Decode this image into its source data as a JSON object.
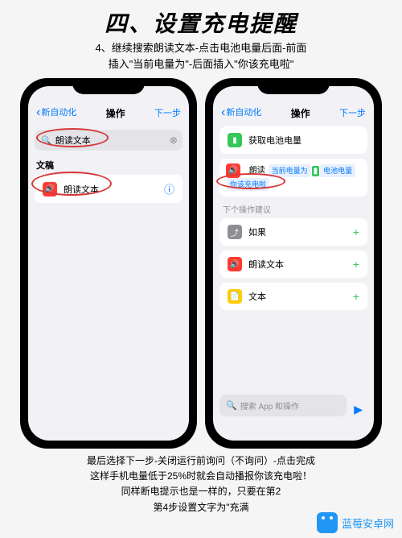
{
  "title": "四、设置充电提醒",
  "subtitle_line1": "4、继续搜索朗读文本-点击电池电量后面-前面",
  "subtitle_line2": "插入\"当前电量为\"-后面插入\"你该充电啦\"",
  "phone_left": {
    "nav_back": "新自动化",
    "nav_title": "操作",
    "nav_next": "下一步",
    "search_value": "朗读文本",
    "section": "文稿",
    "row_label": "朗读文本"
  },
  "phone_right": {
    "nav_back": "新自动化",
    "nav_title": "操作",
    "nav_next": "下一步",
    "row1": "获取电池电量",
    "speak_prefix": "朗读",
    "pill1": "当前电量为",
    "pill2": "电池电量",
    "pill3": "你该充电啦",
    "suggest_label": "下个操作建议",
    "sug1": "如果",
    "sug2": "朗读文本",
    "sug3": "文本",
    "bottom_search": "搜索 App 和操作"
  },
  "footer_line1": "最后选择下一步-关闭运行前询问（不询问）-点击完成",
  "footer_line2": "这样手机电量低于25%时就会自动播报你该充电啦！",
  "footer_line3": "同样断电提示也是一样的，只要在第2",
  "footer_line4": "第4步设置文字为\"充满",
  "watermark": "蓝莓安卓网"
}
